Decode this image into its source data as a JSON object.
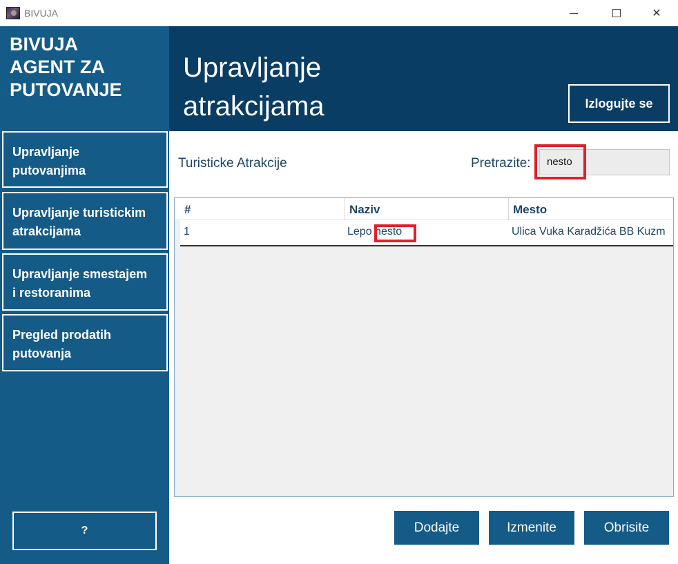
{
  "window": {
    "title": "BIVUJA",
    "icon": "app-logo-icon",
    "controls": [
      "minimize-icon",
      "maximize-icon",
      "close-icon"
    ],
    "close_glyph": "✕"
  },
  "sidebar": {
    "brand": "BIVUJA\nAGENT ZA\nPUTOVANJE",
    "items": [
      {
        "label": "Upravljanje\nputovanjima"
      },
      {
        "label": "Upravljanje turistickim\natrakcijama"
      },
      {
        "label": "Upravljanje smestajem\ni restoranima"
      },
      {
        "label": "Pregled prodatih\nputovanja"
      }
    ],
    "help_label": "?"
  },
  "header": {
    "title": "Upravljanje\natrakcijama",
    "logout_label": "Izlogujte se"
  },
  "content": {
    "section_label": "Turisticke Atrakcije",
    "search_label": "Pretrazite:",
    "search_value": "nesto"
  },
  "table": {
    "columns": [
      "#",
      "Naziv",
      "Mesto"
    ],
    "rows": [
      {
        "num": "1",
        "name": "Lepo nesto",
        "place": "Ulica Vuka Karadžića BB Kuzm"
      }
    ]
  },
  "actions": {
    "add_label": "Dodajte",
    "edit_label": "Izmenite",
    "delete_label": "Obrisite"
  },
  "colors": {
    "sidebar_bg": "#155b87",
    "header_bg": "#0a3d63",
    "highlight": "#e0202a",
    "text_primary": "#1e4666"
  }
}
